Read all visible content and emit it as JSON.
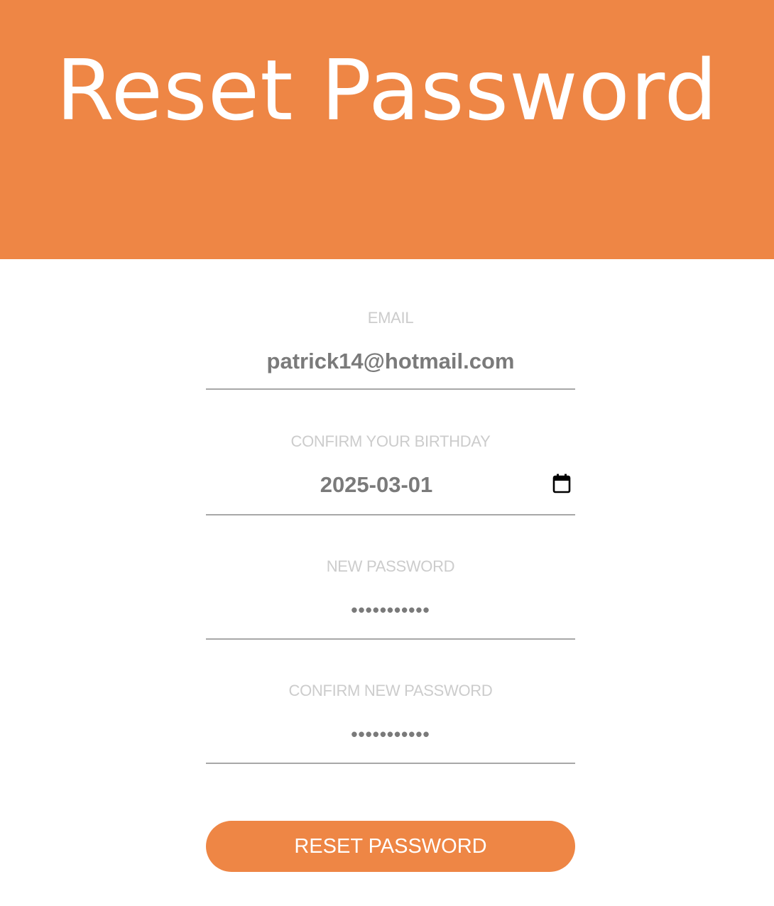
{
  "header": {
    "title": "Reset Password",
    "background_color": "#ee8645"
  },
  "form": {
    "email": {
      "label": "EMAIL",
      "value": "patrick14@hotmail.com"
    },
    "birthday": {
      "label": "CONFIRM YOUR BIRTHDAY",
      "value": "2025-03-01",
      "icon": "calendar-icon"
    },
    "new_password": {
      "label": "NEW PASSWORD",
      "value": "•••••••••••"
    },
    "confirm_password": {
      "label": "CONFIRM NEW PASSWORD",
      "value": "•••••••••••"
    },
    "submit_label": "RESET PASSWORD",
    "accent_color": "#ee8645",
    "label_color": "#cccccc",
    "value_color": "#7a7a7a"
  }
}
